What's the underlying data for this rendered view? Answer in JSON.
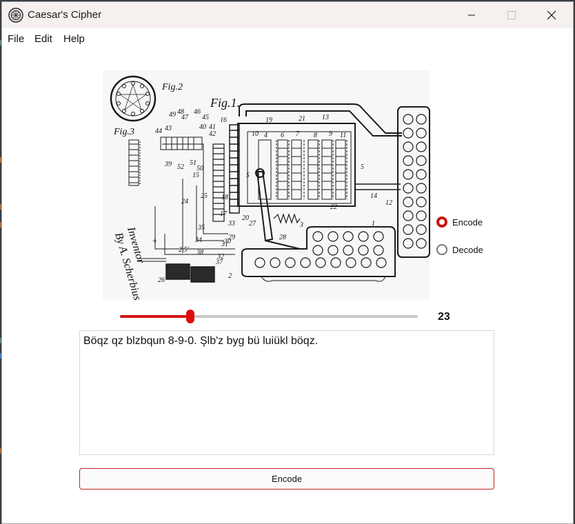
{
  "window": {
    "title": "Caesar's Cipher",
    "controls": [
      "minimize",
      "maximize",
      "close"
    ]
  },
  "menu": [
    "File",
    "Edit",
    "Help"
  ],
  "figure": {
    "icon": "patent-drawing-image",
    "labels": {
      "fig1": "Fig.1.",
      "fig2": "Fig.2",
      "fig3": "Fig.3",
      "signature": "By A. Scherbius",
      "inventor": "Inventor",
      "n1": "1",
      "n2": "2",
      "n3": "3",
      "n4": "4",
      "n5": "5",
      "n6": "6",
      "n7": "7",
      "n8": "8",
      "n9": "9",
      "n10": "10",
      "n11": "11",
      "n12": "12",
      "n13": "13",
      "n14": "14",
      "n15": "15",
      "n16": "16",
      "n17": "17",
      "n18": "18",
      "n19": "19",
      "n20": "20",
      "n21": "21",
      "n22": "22",
      "n24": "24",
      "n25": "25",
      "n26": "26",
      "n27": "27",
      "n28": "28",
      "n29": "29",
      "n30": "30",
      "n31": "31",
      "n32": "32",
      "n33": "33",
      "n34": "34",
      "n35": "35",
      "n37": "37",
      "n38": "38",
      "n39": "39",
      "n40": "40",
      "n41": "41",
      "n42": "42",
      "n43": "43",
      "n44": "44",
      "n45": "45",
      "n46": "46",
      "n47": "47",
      "n48": "48",
      "n49": "49",
      "n50": "50",
      "n51": "51",
      "n52": "52",
      "n25b": "2.5'"
    }
  },
  "mode": {
    "options": [
      {
        "label": "Encode",
        "selected": true
      },
      {
        "label": "Decode",
        "selected": false
      }
    ]
  },
  "shift": {
    "value": "23",
    "min": 0,
    "max": 100,
    "fraction": 0.236
  },
  "text": {
    "content": "Böqz qz blzbqun 8-9-0. Şlb'z byg bü luiükl böqz."
  },
  "action": {
    "label": "Encode"
  },
  "colors": {
    "accent": "#d41414",
    "titlebar": "#f6f1ee"
  }
}
